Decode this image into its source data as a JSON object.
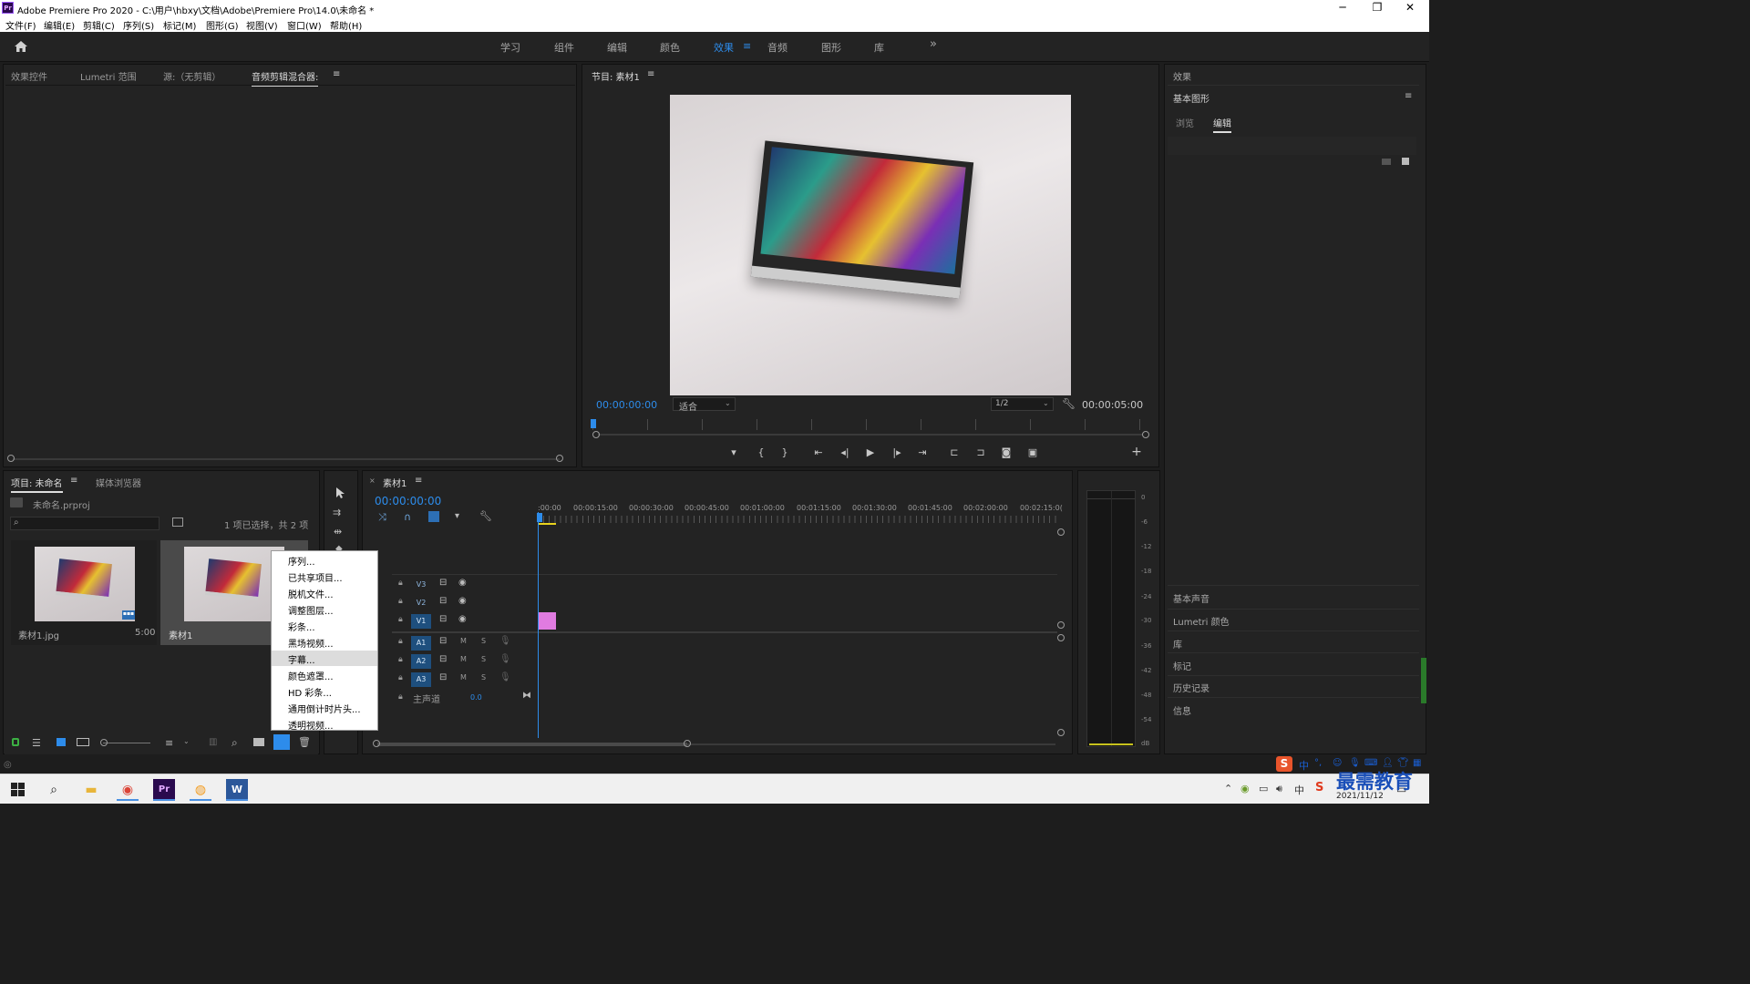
{
  "window": {
    "title": "Adobe Premiere Pro 2020 - C:\\用户\\hbxy\\文档\\Adobe\\Premiere Pro\\14.0\\未命名 *",
    "logo": "Pr",
    "minimize_icon": "─",
    "restore_icon": "❐",
    "close_icon": "✕"
  },
  "menu": [
    "文件(F)",
    "编辑(E)",
    "剪辑(C)",
    "序列(S)",
    "标记(M)",
    "图形(G)",
    "视图(V)",
    "窗口(W)",
    "帮助(H)"
  ],
  "workspaces": {
    "tabs": [
      "学习",
      "组件",
      "编辑",
      "颜色",
      "效果",
      "音频",
      "图形",
      "库"
    ],
    "active": "效果",
    "more": "»",
    "menu_icon": "≡"
  },
  "source_panel": {
    "tabs": [
      "效果控件",
      "Lumetri 范围",
      "源:（无剪辑）",
      "音频剪辑混合器:"
    ],
    "active_tab": "音频剪辑混合器:",
    "menu_icon": "≡"
  },
  "program": {
    "title": "节目: 素材1",
    "menu_icon": "≡",
    "timecode_current": "00:00:00:00",
    "fit": "适合",
    "resolution": "1/2",
    "timecode_duration": "00:00:05:00",
    "controls": [
      "▾",
      "{",
      "}",
      "⇤",
      "◂|",
      "▶",
      "|▸",
      "⇥",
      "⊏",
      "⊐",
      "◙",
      "▣"
    ],
    "add_icon": "+"
  },
  "project": {
    "tabs": [
      "项目: 未命名",
      "媒体浏览器"
    ],
    "menu_icon": "≡",
    "file": "未命名.prproj",
    "selection_status": "1 项已选择，共 2 项",
    "items": [
      {
        "name": "素材1.jpg",
        "duration": "5:00"
      },
      {
        "name": "素材1",
        "duration": ""
      }
    ]
  },
  "context_menu": {
    "items": [
      "序列...",
      "已共享项目...",
      "脱机文件...",
      "调整图层...",
      "彩条...",
      "黑场视频...",
      "字幕...",
      "颜色遮罩...",
      "HD 彩条...",
      "通用倒计时片头...",
      "透明视频..."
    ],
    "highlighted": "字幕..."
  },
  "timeline": {
    "close_icon": "×",
    "title": "素材1",
    "menu_icon": "≡",
    "timecode": "00:00:00:00",
    "ruler": [
      ":00:00",
      "00:00:15:00",
      "00:00:30:00",
      "00:00:45:00",
      "00:01:00:00",
      "00:01:15:00",
      "00:01:30:00",
      "00:01:45:00",
      "00:02:00:00",
      "00:02:15:0("
    ],
    "video_tracks": [
      "V3",
      "V2",
      "V1"
    ],
    "audio_tracks": [
      "A1",
      "A2",
      "A3"
    ],
    "master_label": "主声道",
    "master_value": "0.0",
    "mute": "M",
    "solo": "S",
    "clip_color": "#e07be0"
  },
  "audio_meter": {
    "scale": [
      "0",
      "-6",
      "-12",
      "-18",
      "-24",
      "-30",
      "-36",
      "-42",
      "-48",
      "-54",
      "dB"
    ]
  },
  "right_panel": {
    "effects": "效果",
    "essential_graphics": "基本图形",
    "menu_icon": "≡",
    "tabs": [
      "浏览",
      "编辑"
    ],
    "active_tab": "编辑",
    "sections": [
      "基本声音",
      "Lumetri 颜色",
      "库",
      "标记",
      "历史记录",
      "信息"
    ]
  },
  "taskbar": {
    "apps": [
      "windows-start",
      "search",
      "file-explorer",
      "chrome",
      "premiere",
      "app-5",
      "word"
    ],
    "ime": "中",
    "date": "2021/11/12",
    "watermark": "最需教育"
  },
  "colors": {
    "accent": "#2d8ceb",
    "bg": "#1d1d1d",
    "panel": "#232323",
    "clip": "#e07be0",
    "playhead": "#2d8ceb"
  }
}
